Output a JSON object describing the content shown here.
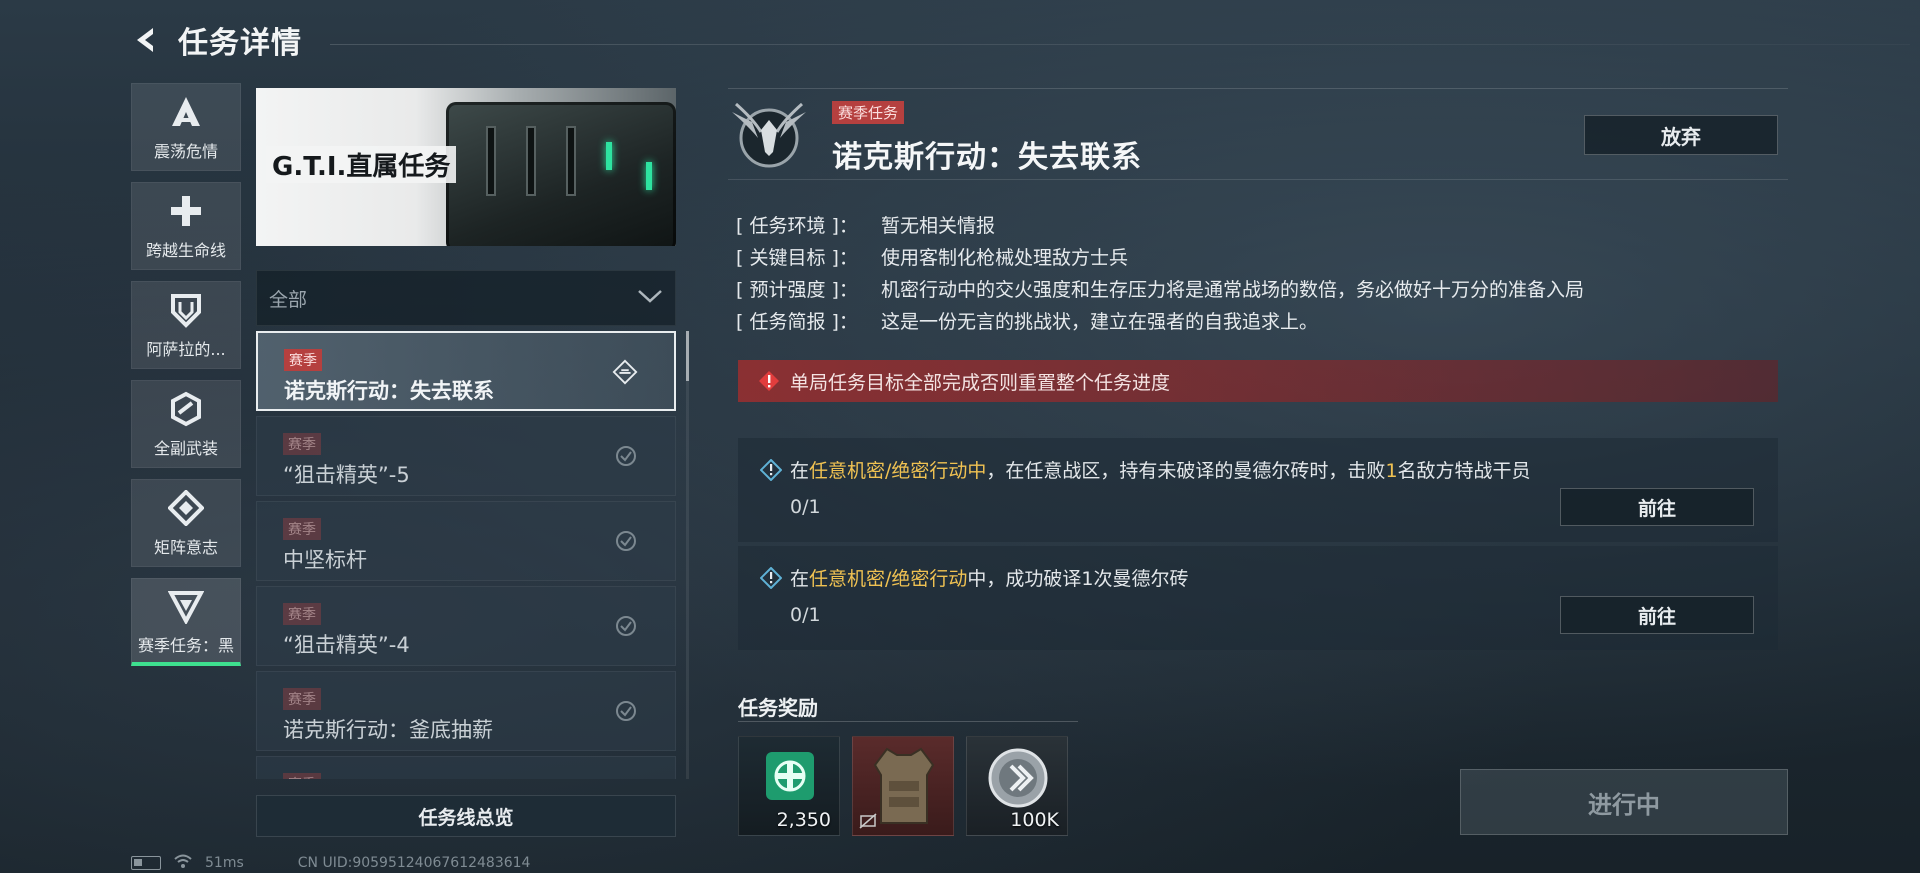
{
  "header": {
    "title": "任务详情"
  },
  "nav": {
    "items": [
      {
        "label": "震荡危情",
        "icon": "a-triangle-icon"
      },
      {
        "label": "跨越生命线",
        "icon": "cross-icon"
      },
      {
        "label": "阿萨拉的...",
        "icon": "shield-icon"
      },
      {
        "label": "全副武装",
        "icon": "hexagon-icon"
      },
      {
        "label": "矩阵意志",
        "icon": "diamond-icon"
      },
      {
        "label": "赛季任务：黑",
        "icon": "g-triangle-icon",
        "active": true
      }
    ]
  },
  "banner": {
    "title": "G.T.I.直属任务"
  },
  "filter": {
    "selected": "全部"
  },
  "quests": [
    {
      "tag": "赛季",
      "name": "诺克斯行动：失去联系",
      "status": "active"
    },
    {
      "tag": "赛季",
      "name": "“狙击精英”-5",
      "status": "done"
    },
    {
      "tag": "赛季",
      "name": "中坚标杆",
      "status": "done"
    },
    {
      "tag": "赛季",
      "name": "“狙击精英”-4",
      "status": "done"
    },
    {
      "tag": "赛季",
      "name": "诺克斯行动：釜底抽薪",
      "status": "done"
    },
    {
      "tag": "赛季",
      "name": "",
      "status": "done"
    }
  ],
  "overview_button": "任务线总览",
  "status_bar": {
    "ping": "51ms",
    "uid": "CN UID:905951240676124836​14"
  },
  "detail": {
    "tag": "赛季任务",
    "title": "诺克斯行动：失去联系",
    "abandon_label": "放弃",
    "info": [
      {
        "key": "[ 任务环境 ]：",
        "value": "暂无相关情报"
      },
      {
        "key": "[ 关键目标 ]：",
        "value": "使用客制化枪械处理敌方士兵"
      },
      {
        "key": "[ 预计强度 ]：",
        "value": "机密行动中的交火强度和生存压力将是通常战场的数倍，务必做好十万分的准备入局"
      },
      {
        "key": "[ 任务简报 ]：",
        "value": "这是一份无言的挑战状，建立在强者的自我追求上。"
      }
    ],
    "warning": "单局任务目标全部完成否则重置整个任务进度",
    "objectives": [
      {
        "pre": "在",
        "hl": "任意机密/绝密行动中",
        "mid": "，在任意战区，持有未破译的曼德尔砖时，击败",
        "hl2": "1",
        "post": "名敌方特战干员",
        "progress": "0/1",
        "button": "前往"
      },
      {
        "pre": "在",
        "hl": "任意机密/绝密行动",
        "mid": "中，成功破译1次曼德尔砖",
        "hl2": "",
        "post": "",
        "progress": "0/1",
        "button": "前往"
      }
    ],
    "rewards_title": "任务奖励",
    "rewards": [
      {
        "qty": "2,350",
        "icon": "exp-badge-icon"
      },
      {
        "qty": "",
        "icon": "body-armor-icon"
      },
      {
        "qty": "100K",
        "icon": "coin-icon"
      }
    ],
    "progress_button": "进行中"
  },
  "colors": {
    "accent": "#3ee08f",
    "tag_red": "#b5403f",
    "highlight": "#f0c252"
  }
}
